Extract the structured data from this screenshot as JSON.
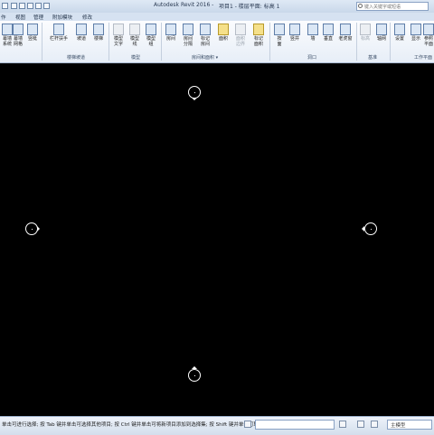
{
  "window": {
    "title": "Autodesk Revit 2016 -",
    "project": "项目1 - 楼层平面: 标高 1",
    "search_placeholder": "键入关键字或短语"
  },
  "tabs": [
    "作",
    "视图",
    "管理",
    "附加模块",
    "修改"
  ],
  "ribbon": {
    "buttons": [
      {
        "label": "幕墙\n系统",
        "icon": "curtain-system-icon"
      },
      {
        "label": "幕墙\n网格",
        "icon": "curtain-grid-icon"
      },
      {
        "label": "竖梃",
        "icon": "mullion-icon"
      },
      {
        "label": "栏杆扶手",
        "icon": "railing-icon"
      },
      {
        "label": "坡道",
        "icon": "ramp-icon"
      },
      {
        "label": "楼梯",
        "icon": "stair-icon"
      },
      {
        "label": "模型\n文字",
        "icon": "model-text-icon"
      },
      {
        "label": "模型\n线",
        "icon": "model-line-icon"
      },
      {
        "label": "模型\n组",
        "icon": "model-group-icon"
      },
      {
        "label": "房间",
        "icon": "room-icon"
      },
      {
        "label": "房间\n分隔",
        "icon": "room-separator-icon"
      },
      {
        "label": "标记\n房间",
        "icon": "tag-room-icon"
      },
      {
        "label": "面积",
        "icon": "area-icon"
      },
      {
        "label": "面积\n边界",
        "icon": "area-boundary-icon"
      },
      {
        "label": "标记\n面积",
        "icon": "tag-area-icon"
      },
      {
        "label": "按\n面",
        "icon": "by-face-icon"
      },
      {
        "label": "竖井",
        "icon": "shaft-icon"
      },
      {
        "label": "墙",
        "icon": "wall-opening-icon"
      },
      {
        "label": "垂直",
        "icon": "vertical-opening-icon"
      },
      {
        "label": "老虎窗",
        "icon": "dormer-icon"
      },
      {
        "label": "标高",
        "icon": "level-icon"
      },
      {
        "label": "轴网",
        "icon": "grid-icon"
      },
      {
        "label": "设置",
        "icon": "set-workplane-icon"
      },
      {
        "label": "显示",
        "icon": "show-workplane-icon"
      },
      {
        "label": "参照\n平面",
        "icon": "ref-plane-icon"
      }
    ],
    "groups": [
      "模型",
      "楼梯坡道",
      "模型",
      "房间和面积 ▾",
      "洞口",
      "基准",
      "工作平面"
    ]
  },
  "viewport": {
    "background": "#000000",
    "elevation_markers": [
      "north",
      "west",
      "east",
      "south"
    ]
  },
  "status": {
    "text": "单击可进行选择; 按 Tab 键并单击可选择其他项目; 按 Ctrl 键并单击可将新项目添加到选择集; 按 Shift 键并单击可取消选择。",
    "model_label": "主模型"
  }
}
